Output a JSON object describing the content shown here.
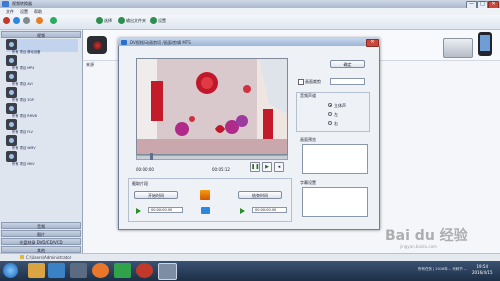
{
  "app": {
    "title": "视频转换器",
    "menu": [
      "文件",
      "设置",
      "帮助"
    ],
    "toolbar": {
      "item1": "选择",
      "item2": "输出文件夹",
      "item3": "设置"
    },
    "window_buttons": {
      "minimize": "—",
      "maximize": "□",
      "close": "✕"
    }
  },
  "left_panel": {
    "header_top": "视频",
    "items": [
      "所有 项目 移动设备",
      "所有 项目 MP4",
      "所有 项目 AVI",
      "所有 项目 3GP",
      "所有 项目 RMVB",
      "所有 项目 FLV",
      "所有 项目 WMV",
      "所有 项目 MKV"
    ],
    "footer_items": [
      "音频",
      "图片",
      "光盘刻录 DVD/CD/VCD",
      "其他"
    ]
  },
  "main": {
    "column_header": "来源"
  },
  "dialog": {
    "title": "DV视频/动画剪切 /画面/剪辑 MTS",
    "time_start": "00:00:00",
    "time_end": "00:05:12",
    "confirm_button": "确定",
    "checkbox_label": "画面裁剪",
    "audio_group": "音频声道",
    "audio_options": [
      "立体声",
      "左",
      "右"
    ],
    "preview_group": "画面预览",
    "subtitle_group": "字幕设置",
    "clip_group": "截取片段",
    "start_button": "开始时间",
    "end_button": "结束时间",
    "start_value": "00:00:00.00",
    "end_value": "00:00:00.00",
    "video_text": {
      "left": "福\n在\n德\n门",
      "right": "字\n来\n春"
    }
  },
  "statusbar": {
    "path": "C:\\Users\\Administrator"
  },
  "taskbar": {
    "time": "19:54",
    "date": "2016/4/15",
    "tray_text": "所有任务 | 2016年... 代码节 ..."
  },
  "watermark": {
    "text": "Bai du 经验",
    "sub": "jingyan.baidu.com"
  },
  "colors": {
    "accent": "#3a7bd5",
    "titlebar": "#aab8cc",
    "taskbar": "#1d2f47",
    "close": "#c9473c"
  }
}
